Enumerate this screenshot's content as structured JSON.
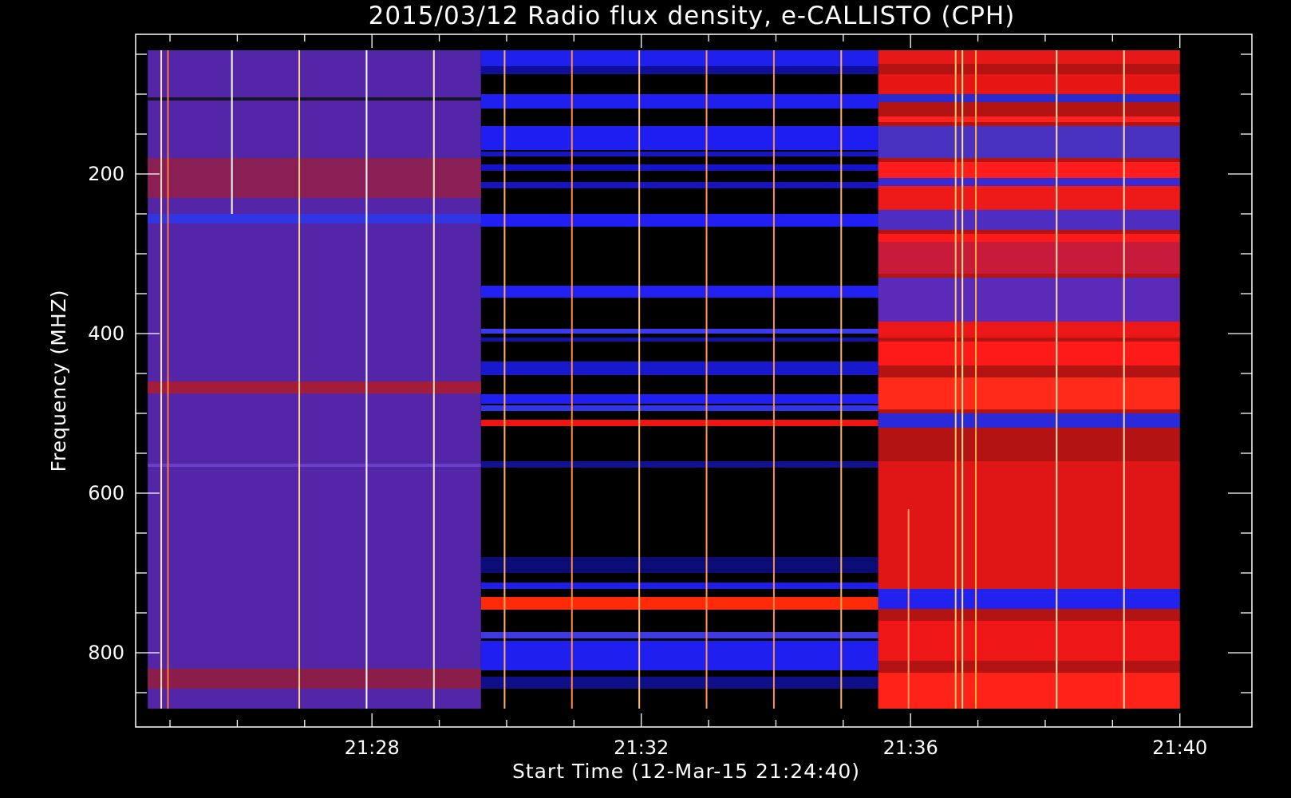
{
  "chart_data": {
    "type": "heatmap",
    "subtype": "dynamic-radio-spectrogram",
    "title": "2015/03/12  Radio flux density, e-CALLISTO (CPH)",
    "xlabel": "Start Time (12-Mar-15 21:24:40)",
    "ylabel": "Frequency (MHZ)",
    "x_axis": {
      "unit": "minutes after 21:24:40",
      "range": [
        -0.18,
        16.4
      ],
      "labeled_ticks": [
        {
          "value": 3.33,
          "label": "21:28"
        },
        {
          "value": 7.33,
          "label": "21:32"
        },
        {
          "value": 11.33,
          "label": "21:36"
        },
        {
          "value": 15.33,
          "label": "21:40"
        }
      ],
      "minor_ticks": [
        0.33,
        1.33,
        2.33,
        4.33,
        5.33,
        6.33,
        8.33,
        9.33,
        10.33,
        12.33,
        13.33,
        14.33
      ]
    },
    "y_axis": {
      "unit": "MHz",
      "inverted": true,
      "range": [
        25,
        893
      ],
      "labeled_ticks": [
        {
          "value": 200,
          "label": "200"
        },
        {
          "value": 400,
          "label": "400"
        },
        {
          "value": 600,
          "label": "600"
        },
        {
          "value": 800,
          "label": "800"
        }
      ],
      "minor_ticks": [
        50,
        100,
        150,
        250,
        300,
        350,
        450,
        500,
        550,
        650,
        700,
        750,
        850
      ]
    },
    "data_extent": {
      "t_start": 0.0,
      "t_end": 15.33,
      "f_min": 45,
      "f_max": 870
    },
    "segments": [
      {
        "t_start": 0.0,
        "t_end": 4.95,
        "background": "#5226a6"
      },
      {
        "t_start": 4.95,
        "t_end": 10.85,
        "background": "#000000"
      },
      {
        "t_start": 10.85,
        "t_end": 15.33,
        "background": "#b41313"
      }
    ],
    "bands": [
      {
        "segment": 0,
        "f1": 104,
        "f2": 108,
        "color": "#151528"
      },
      {
        "segment": 0,
        "f1": 180,
        "f2": 230,
        "color": "#8a1f55"
      },
      {
        "segment": 0,
        "f1": 250,
        "f2": 262,
        "color": "#3335e2"
      },
      {
        "segment": 0,
        "f1": 460,
        "f2": 475,
        "color": "#a31d3a"
      },
      {
        "segment": 0,
        "f1": 563,
        "f2": 567,
        "color": "#6a40c8"
      },
      {
        "segment": 0,
        "f1": 820,
        "f2": 845,
        "color": "#8a1d4a"
      },
      {
        "segment": 1,
        "f1": 45,
        "f2": 65,
        "color": "#1f1fee"
      },
      {
        "segment": 1,
        "f1": 65,
        "f2": 75,
        "color": "#0f0f99"
      },
      {
        "segment": 1,
        "f1": 100,
        "f2": 118,
        "color": "#1f1ff0"
      },
      {
        "segment": 1,
        "f1": 140,
        "f2": 170,
        "color": "#1e1ef2"
      },
      {
        "segment": 1,
        "f1": 172,
        "f2": 178,
        "color": "#1616c2"
      },
      {
        "segment": 1,
        "f1": 188,
        "f2": 196,
        "color": "#1414c8"
      },
      {
        "segment": 1,
        "f1": 210,
        "f2": 218,
        "color": "#1515bb"
      },
      {
        "segment": 1,
        "f1": 250,
        "f2": 266,
        "color": "#2020f4"
      },
      {
        "segment": 1,
        "f1": 340,
        "f2": 355,
        "color": "#2121f2"
      },
      {
        "segment": 1,
        "f1": 394,
        "f2": 400,
        "color": "#3a3af0"
      },
      {
        "segment": 1,
        "f1": 405,
        "f2": 410,
        "color": "#1212a8"
      },
      {
        "segment": 1,
        "f1": 435,
        "f2": 452,
        "color": "#1818cc"
      },
      {
        "segment": 1,
        "f1": 476,
        "f2": 488,
        "color": "#1f1ff0"
      },
      {
        "segment": 1,
        "f1": 490,
        "f2": 497,
        "color": "#3434ea"
      },
      {
        "segment": 1,
        "f1": 508,
        "f2": 516,
        "color": "#ee1414"
      },
      {
        "segment": 1,
        "f1": 560,
        "f2": 568,
        "color": "#121290"
      },
      {
        "segment": 1,
        "f1": 680,
        "f2": 700,
        "color": "#0c0c77"
      },
      {
        "segment": 1,
        "f1": 712,
        "f2": 720,
        "color": "#1e1ee6"
      },
      {
        "segment": 1,
        "f1": 730,
        "f2": 746,
        "color": "#ff2a0a"
      },
      {
        "segment": 1,
        "f1": 774,
        "f2": 782,
        "color": "#4038e0"
      },
      {
        "segment": 1,
        "f1": 785,
        "f2": 822,
        "color": "#1f1ff0"
      },
      {
        "segment": 1,
        "f1": 830,
        "f2": 845,
        "color": "#0f0f8a"
      },
      {
        "segment": 2,
        "f1": 45,
        "f2": 62,
        "color": "#e61818"
      },
      {
        "segment": 2,
        "f1": 75,
        "f2": 100,
        "color": "#e81515"
      },
      {
        "segment": 2,
        "f1": 100,
        "f2": 110,
        "color": "#2b2bcc"
      },
      {
        "segment": 2,
        "f1": 128,
        "f2": 135,
        "color": "#ff2020"
      },
      {
        "segment": 2,
        "f1": 140,
        "f2": 180,
        "color": "#4a32c0"
      },
      {
        "segment": 2,
        "f1": 185,
        "f2": 205,
        "color": "#ff1c1c"
      },
      {
        "segment": 2,
        "f1": 205,
        "f2": 215,
        "color": "#3a2ad0"
      },
      {
        "segment": 2,
        "f1": 215,
        "f2": 245,
        "color": "#ee1a1a"
      },
      {
        "segment": 2,
        "f1": 245,
        "f2": 270,
        "color": "#4e2ec0"
      },
      {
        "segment": 2,
        "f1": 275,
        "f2": 285,
        "color": "#ff1a1a"
      },
      {
        "segment": 2,
        "f1": 285,
        "f2": 325,
        "color": "#c81a3a"
      },
      {
        "segment": 2,
        "f1": 330,
        "f2": 385,
        "color": "#5a2ab8"
      },
      {
        "segment": 2,
        "f1": 385,
        "f2": 405,
        "color": "#ee1717"
      },
      {
        "segment": 2,
        "f1": 410,
        "f2": 440,
        "color": "#ff1a1a"
      },
      {
        "segment": 2,
        "f1": 455,
        "f2": 495,
        "color": "#ff2a1a"
      },
      {
        "segment": 2,
        "f1": 500,
        "f2": 518,
        "color": "#2a2ad8"
      },
      {
        "segment": 2,
        "f1": 560,
        "f2": 720,
        "color": "#e01515"
      },
      {
        "segment": 2,
        "f1": 720,
        "f2": 745,
        "color": "#2222ee"
      },
      {
        "segment": 2,
        "f1": 760,
        "f2": 810,
        "color": "#ee1616"
      },
      {
        "segment": 2,
        "f1": 825,
        "f2": 870,
        "color": "#ff2218"
      }
    ],
    "bursts": [
      {
        "t": 0.2,
        "f1": 45,
        "f2": 870,
        "color": "#ffe0b0"
      },
      {
        "t": 0.3,
        "f1": 45,
        "f2": 870,
        "color": "#ff7a40"
      },
      {
        "t": 1.25,
        "f1": 45,
        "f2": 250,
        "color": "#ffffff"
      },
      {
        "t": 2.25,
        "f1": 45,
        "f2": 870,
        "color": "#ffd080"
      },
      {
        "t": 3.25,
        "f1": 45,
        "f2": 870,
        "color": "#ffffff"
      },
      {
        "t": 4.25,
        "f1": 45,
        "f2": 870,
        "color": "#ffe8c0"
      },
      {
        "t": 5.3,
        "f1": 45,
        "f2": 870,
        "color": "#ffb060"
      },
      {
        "t": 6.3,
        "f1": 45,
        "f2": 870,
        "color": "#ff8a40"
      },
      {
        "t": 7.3,
        "f1": 45,
        "f2": 870,
        "color": "#ffc070"
      },
      {
        "t": 8.3,
        "f1": 45,
        "f2": 870,
        "color": "#ff9a50"
      },
      {
        "t": 9.3,
        "f1": 45,
        "f2": 870,
        "color": "#ff9040"
      },
      {
        "t": 10.3,
        "f1": 45,
        "f2": 870,
        "color": "#ffb050"
      },
      {
        "t": 11.3,
        "f1": 620,
        "f2": 870,
        "color": "#ff9a60"
      },
      {
        "t": 12.0,
        "f1": 45,
        "f2": 870,
        "color": "#ffd060"
      },
      {
        "t": 12.1,
        "f1": 45,
        "f2": 870,
        "color": "#ffe090"
      },
      {
        "t": 12.3,
        "f1": 45,
        "f2": 870,
        "color": "#ffb040"
      },
      {
        "t": 13.5,
        "f1": 45,
        "f2": 870,
        "color": "#ffe0b0"
      },
      {
        "t": 14.5,
        "f1": 45,
        "f2": 870,
        "color": "#ffe0b0"
      }
    ]
  }
}
